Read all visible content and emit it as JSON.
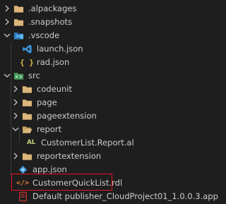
{
  "explorer": {
    "items": [
      {
        "label": ".alpackages",
        "kind": "folder",
        "expanded": false
      },
      {
        "label": ".snapshots",
        "kind": "folder",
        "expanded": false
      },
      {
        "label": ".vscode",
        "kind": "vscode-folder",
        "expanded": true
      },
      {
        "label": "launch.json",
        "kind": "json-file"
      },
      {
        "label": "rad.json",
        "kind": "json-file"
      },
      {
        "label": "src",
        "kind": "folder",
        "expanded": true
      },
      {
        "label": "codeunit",
        "kind": "folder",
        "expanded": false
      },
      {
        "label": "page",
        "kind": "folder",
        "expanded": false
      },
      {
        "label": "pageextension",
        "kind": "folder",
        "expanded": false
      },
      {
        "label": "report",
        "kind": "folder",
        "expanded": true
      },
      {
        "label": "CustomerList.Report.al",
        "kind": "al-file",
        "icon_text": "AL"
      },
      {
        "label": "reportextension",
        "kind": "folder",
        "expanded": false
      },
      {
        "label": "app.json",
        "kind": "app-json-file"
      },
      {
        "label": "CustomerQuickList.rdl",
        "kind": "rdl-file",
        "icon_text": "</>",
        "highlighted": true
      },
      {
        "label": "Default publisher_CloudProject01_1.0.0.3.app",
        "kind": "app-file"
      }
    ]
  },
  "colors": {
    "background": "#1e1e1e",
    "text": "#cccccc",
    "folder": "#dcb67a",
    "highlight_border": "#e81123",
    "vscode_blue": "#3a96dd",
    "json_yellow": "#d7ba4a",
    "al_green": "#b8d078",
    "rdl_orange": "#e37933",
    "app_red": "#c5352f"
  }
}
